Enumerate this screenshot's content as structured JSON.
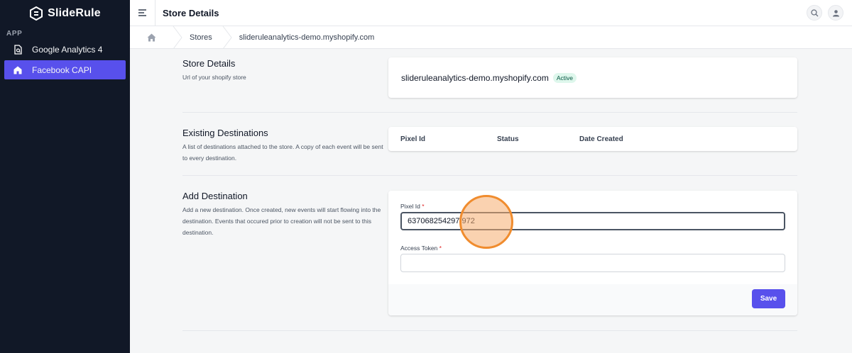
{
  "sidebar": {
    "brand": "SlideRule",
    "section": "APP",
    "items": [
      {
        "label": "Google Analytics 4",
        "icon": "analytics-doc-icon"
      },
      {
        "label": "Facebook CAPI",
        "icon": "store-icon",
        "active": true
      }
    ]
  },
  "topbar": {
    "title": "Store Details"
  },
  "breadcrumb": {
    "items": [
      "Stores",
      "slideruleanalytics-demo.myshopify.com"
    ]
  },
  "store_details": {
    "title": "Store Details",
    "description": "Url of your shopify store",
    "url": "slideruleanalytics-demo.myshopify.com",
    "status": "Active"
  },
  "existing_destinations": {
    "title": "Existing Destinations",
    "description": "A list of destinations attached to the store. A copy of each event will be sent to every destination.",
    "columns": [
      "Pixel Id",
      "Status",
      "Date Created"
    ]
  },
  "add_destination": {
    "title": "Add Destination",
    "description": "Add a new destination. Once created, new events will start flowing into the destination. Events that occured prior to creation will not be sent to this destination.",
    "pixel_label": "Pixel Id",
    "pixel_value": "637068254297 972",
    "token_label": "Access Token",
    "token_value": "",
    "required_mark": "*",
    "save_label": "Save"
  },
  "colors": {
    "accent": "#5850ec",
    "sidebar": "#111827",
    "badge_bg": "#def7ec",
    "cursor": "#f08c2e"
  }
}
